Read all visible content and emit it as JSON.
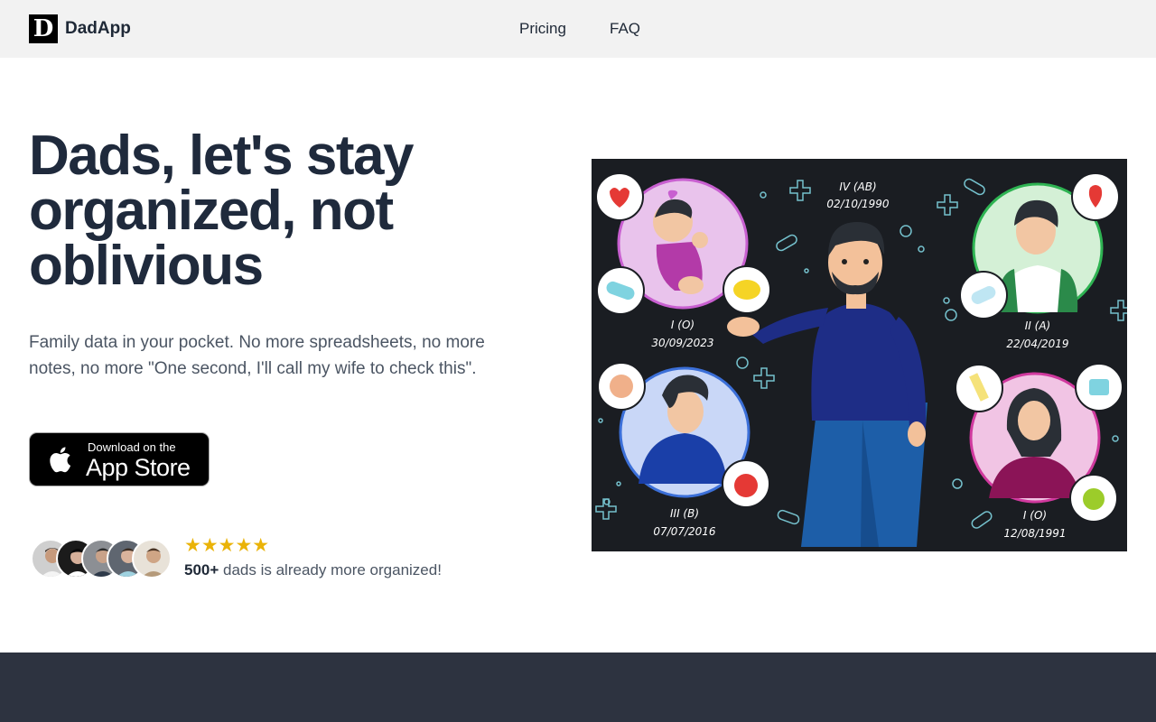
{
  "header": {
    "logo_letter": "D",
    "brand": "DadApp",
    "nav": [
      "Pricing",
      "FAQ"
    ]
  },
  "hero": {
    "title": "Dads, let's stay organized, not oblivious",
    "subtitle": "Family data in your pocket. No more spreadsheets, no more notes, no more \"One second, I'll call my wife to check this\".",
    "appstore": {
      "small": "Download on the",
      "big": "App Store"
    }
  },
  "social_proof": {
    "stars": "★★★★★",
    "count": "500+",
    "text": " dads is already more organized!"
  },
  "illustration": {
    "labels": [
      {
        "blood": "IV (AB)",
        "date": "02/10/1990"
      },
      {
        "blood": "I (O)",
        "date": "30/09/2023"
      },
      {
        "blood": "II (A)",
        "date": "22/04/2019"
      },
      {
        "blood": "III (B)",
        "date": "07/07/2016"
      },
      {
        "blood": "I (O)",
        "date": "12/08/1991"
      }
    ]
  },
  "colors": {
    "header_bg": "#f2f2f2",
    "title": "#1f2a3c",
    "star": "#eab308",
    "illustration_bg": "#1a1d22",
    "footer_band": "#2d3340"
  }
}
